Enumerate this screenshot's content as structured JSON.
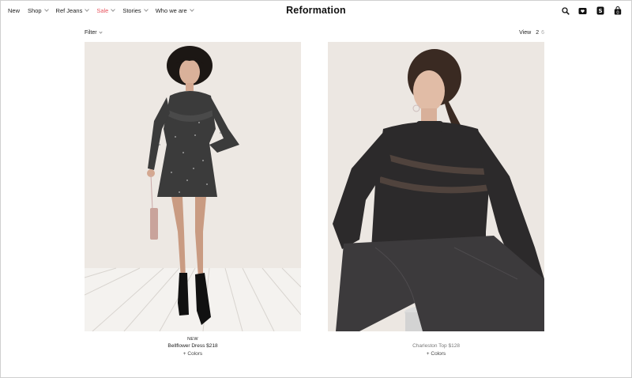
{
  "header": {
    "nav": [
      {
        "label": "New",
        "has_caret": false,
        "sale": false
      },
      {
        "label": "Shop",
        "has_caret": true,
        "sale": false
      },
      {
        "label": "Ref Jeans",
        "has_caret": true,
        "sale": false
      },
      {
        "label": "Sale",
        "has_caret": true,
        "sale": true
      },
      {
        "label": "Stories",
        "has_caret": true,
        "sale": false
      },
      {
        "label": "Who we are",
        "has_caret": true,
        "sale": false
      }
    ],
    "brand": "Reformation",
    "icons": [
      "search-icon",
      "wishlist-heart-icon",
      "account-icon",
      "shopping-bag-icon"
    ]
  },
  "toolbar": {
    "filter_label": "Filter",
    "view_label": "View",
    "view_options": [
      "2",
      "6"
    ],
    "view_selected": "2"
  },
  "products": [
    {
      "badge": "NEW",
      "name": "Bellflower Dress $218",
      "colors": "+ Colors"
    },
    {
      "badge": "",
      "name": "Charleston Top $128",
      "colors": "+ Colors"
    }
  ],
  "colors": {
    "sale": "#e8545f",
    "photo_bg": "#ede8e3",
    "muted_text": "#777777"
  }
}
